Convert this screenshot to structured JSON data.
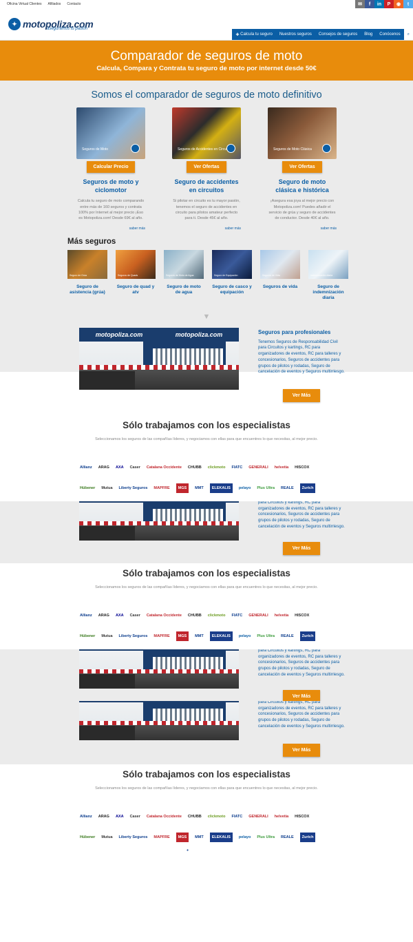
{
  "top_links": [
    "Oficina Virtual Clientes",
    "Afiliados",
    "Contacto"
  ],
  "social": [
    {
      "icon": "mail-icon",
      "glyph": "✉",
      "color": "#777777"
    },
    {
      "icon": "facebook-icon",
      "glyph": "f",
      "color": "#3b5998"
    },
    {
      "icon": "linkedin-icon",
      "glyph": "in",
      "color": "#0077b5"
    },
    {
      "icon": "pinterest-icon",
      "glyph": "P",
      "color": "#cb2027"
    },
    {
      "icon": "rss-icon",
      "glyph": "◉",
      "color": "#f26522"
    },
    {
      "icon": "twitter-icon",
      "glyph": "t",
      "color": "#55acee"
    }
  ],
  "brand": {
    "name": "motopoliza.com",
    "tagline": "aseguramos tu pasión"
  },
  "nav": [
    "Calcula tu seguro",
    "Nuestros seguros",
    "Consejos de seguros",
    "Blog",
    "Conócenos"
  ],
  "hero": {
    "title": "Comparador de seguros de moto",
    "subtitle": "Calcula, Compara y Contrata tu seguro de moto por internet desde 50€"
  },
  "section_title": "Somos el comparador de seguros de moto definitivo",
  "cards": [
    {
      "tag": "Seguros de Moto",
      "button": "Calcular Precio",
      "title": "Seguros de moto y ciclomotor",
      "text": "Calcula tu seguro de moto comparando entre más de 160 seguros y contrata 100% por Internet al mejor precio ¡Eso es Motopoliza.com! Desde 69€ al año.",
      "more": "saber más"
    },
    {
      "tag": "Seguros de Accidentes en Circuito",
      "button": "Ver Ofertas",
      "title": "Seguro de accidentes en circuitos",
      "text": "Si pilotar en circuito es tu mayor pasión, tenemos el seguro de accidentes en circuito para pilotos amateur perfecto para ti. Desde 45€ al año.",
      "more": "saber más"
    },
    {
      "tag": "Seguros de Moto Clásica",
      "button": "Ver Ofertas",
      "title": "Seguro de moto clásica e histórica",
      "text": "¡Asegura esa joya al mejor precio con Motopoliza.com! Puedes añadir el servicio de grúa y seguro de accidentes de conductor. Desde 40€ al año.",
      "more": "saber más"
    }
  ],
  "mas_title": "Más seguros",
  "mas": [
    {
      "label": "Seguro de asistencia (grúa)",
      "tag": "Seguro de Grúa"
    },
    {
      "label": "Seguro de quad y atv",
      "tag": "Seguros de Quads"
    },
    {
      "label": "Seguro de moto de agua",
      "tag": "Seguros de Moto de Agua"
    },
    {
      "label": "Seguro de casco y equipación",
      "tag": "Seguro de Equipación"
    },
    {
      "label": "Seguros de vida",
      "tag": "Seguros de Vida"
    },
    {
      "label": "Seguro de indemnización diaria",
      "tag": "Indemnización diaria"
    }
  ],
  "pro": {
    "title": "Seguros para profesionales",
    "text": "Tenemos Seguros de Responsabilidad Civil para Circuitos y kartings, RC para organizadores de eventos, RC para talleres y concesionarios,  Seguros de accidentes para grupos de pilotos y rodadas, Seguro de cancelación de eventos y Seguros multirriesgo.",
    "button": "Ver Más",
    "track_brand": "motopoliza.com"
  },
  "spec": {
    "title": "Sólo trabajamos con los especialistas",
    "text": "Seleccionamos los seguros de las compañías líderes, y negociamos con ellas para que encuentres lo que necesitas, al mejor precio."
  },
  "logos_row1": [
    {
      "name": "Allianz",
      "color": "#0b3c8c"
    },
    {
      "name": "ARAG",
      "color": "#222222"
    },
    {
      "name": "AXA",
      "color": "#00008f"
    },
    {
      "name": "Caser",
      "color": "#333333"
    },
    {
      "name": "Catalana Occidente",
      "color": "#c0262d"
    },
    {
      "name": "CHUBB",
      "color": "#222222"
    },
    {
      "name": "clickmoto",
      "color": "#6a9a1e"
    },
    {
      "name": "FIATC",
      "color": "#0b3c8c"
    },
    {
      "name": "GENERALI",
      "color": "#c0262d"
    },
    {
      "name": "helvetia",
      "color": "#c0262d"
    },
    {
      "name": "HISCOX",
      "color": "#222222"
    }
  ],
  "logos_row2": [
    {
      "name": "Hübener",
      "color": "#3a7a1e"
    },
    {
      "name": "Mutua",
      "color": "#333333"
    },
    {
      "name": "Liberty Seguros",
      "color": "#0b3c8c"
    },
    {
      "name": "MAPFRE",
      "color": "#c0262d"
    },
    {
      "name": "MGS",
      "color": "#ffffff"
    },
    {
      "name": "MMT",
      "color": "#0b3c8c"
    },
    {
      "name": "ELEKALIS",
      "color": "#ffffff"
    },
    {
      "name": "pelayo",
      "color": "#0b5ea5"
    },
    {
      "name": "Plus Ultra",
      "color": "#3a9a3a"
    },
    {
      "name": "REALE",
      "color": "#0b3c8c"
    },
    {
      "name": "Zurich",
      "color": "#ffffff"
    }
  ]
}
